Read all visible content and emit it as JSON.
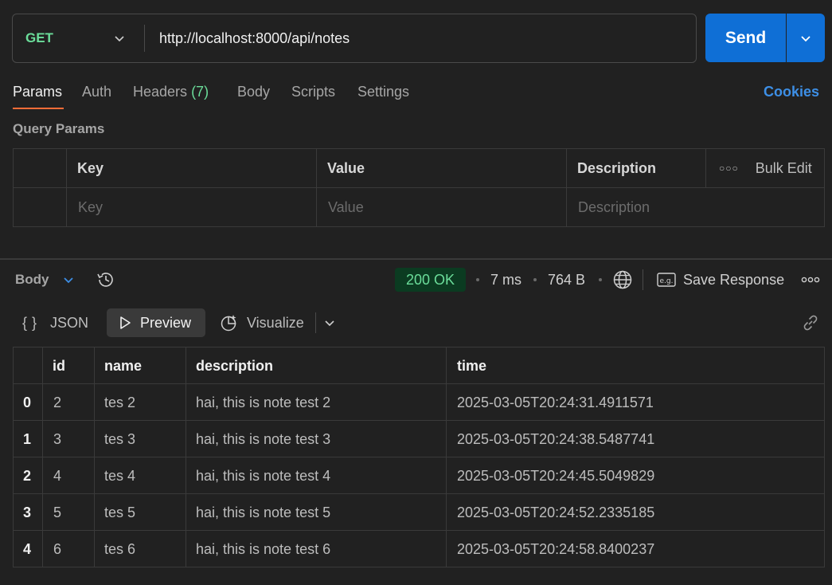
{
  "request": {
    "method": "GET",
    "url": "http://localhost:8000/api/notes",
    "send_label": "Send"
  },
  "tabs": [
    {
      "label": "Params"
    },
    {
      "label": "Auth"
    },
    {
      "label": "Headers",
      "count": "(7)"
    },
    {
      "label": "Body"
    },
    {
      "label": "Scripts"
    },
    {
      "label": "Settings"
    }
  ],
  "cookies_label": "Cookies",
  "query_params": {
    "title": "Query Params",
    "headers": [
      "Key",
      "Value",
      "Description"
    ],
    "bulk_edit": "Bulk Edit",
    "placeholders": [
      "Key",
      "Value",
      "Description"
    ]
  },
  "response": {
    "section_label": "Body",
    "status": "200 OK",
    "time": "7 ms",
    "size": "764 B",
    "save_label": "Save Response",
    "views": {
      "json": "JSON",
      "preview": "Preview",
      "visualize": "Visualize"
    },
    "columns": [
      "id",
      "name",
      "description",
      "time"
    ],
    "rows": [
      {
        "index": "0",
        "id": "2",
        "name": "tes 2",
        "description": "hai, this is note test 2",
        "time": "2025-03-05T20:24:31.4911571"
      },
      {
        "index": "1",
        "id": "3",
        "name": "tes 3",
        "description": "hai, this is note test 3",
        "time": "2025-03-05T20:24:38.5487741"
      },
      {
        "index": "2",
        "id": "4",
        "name": "tes 4",
        "description": "hai, this is note test 4",
        "time": "2025-03-05T20:24:45.5049829"
      },
      {
        "index": "3",
        "id": "5",
        "name": "tes 5",
        "description": "hai, this is note test 5",
        "time": "2025-03-05T20:24:52.2335185"
      },
      {
        "index": "4",
        "id": "6",
        "name": "tes 6",
        "description": "hai, this is note test 6",
        "time": "2025-03-05T20:24:58.8400237"
      }
    ]
  },
  "colors": {
    "accent": "#0f6fd6",
    "method_get": "#6bdd9a",
    "tab_indicator": "#ff6c37",
    "link": "#3d8fe6",
    "status_bg": "#0b3b21"
  }
}
